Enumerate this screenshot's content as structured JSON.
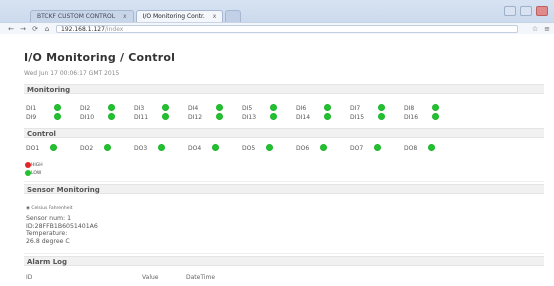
{
  "browser": {
    "tabs": [
      {
        "label": "BTCKF CUSTOM CONTROL",
        "active": false
      },
      {
        "label": "I/O Monitoring Contr.",
        "active": true
      }
    ],
    "close_label": "x",
    "address": "192.168.1.127",
    "address_muted": "/index"
  },
  "page": {
    "title": "I/O Monitoring / Control",
    "subtitle": "Wed Jun 17 00:06:17 GMT 2015"
  },
  "monitoring": {
    "header": "Monitoring",
    "rows": [
      [
        "DI1",
        "DI2",
        "DI3",
        "DI4",
        "DI5",
        "DI6",
        "DI7",
        "DI8"
      ],
      [
        "DI9",
        "DI10",
        "DI11",
        "DI12",
        "DI13",
        "DI14",
        "DI15",
        "DI16"
      ]
    ]
  },
  "control": {
    "header": "Control",
    "outputs": [
      "DO1",
      "DO2",
      "DO3",
      "DO4",
      "DO5",
      "DO6",
      "DO7",
      "DO8"
    ]
  },
  "legend": {
    "high": "HIGH",
    "low": "LOW"
  },
  "sensor_monitoring": {
    "header": "Sensor Monitoring",
    "units": "Celsius  Fahrenheit",
    "sensor_num": "Sensor num: 1",
    "id": "ID:28FFB1B6051401A6",
    "temp_label": "Temperature:",
    "temp_value": "26.8 degree C"
  },
  "alarm_log": {
    "header": "Alarm Log",
    "columns": [
      "ID",
      "Value",
      "DateTime"
    ]
  },
  "colors": {
    "green": "#21c12f",
    "red": "#e02727"
  }
}
